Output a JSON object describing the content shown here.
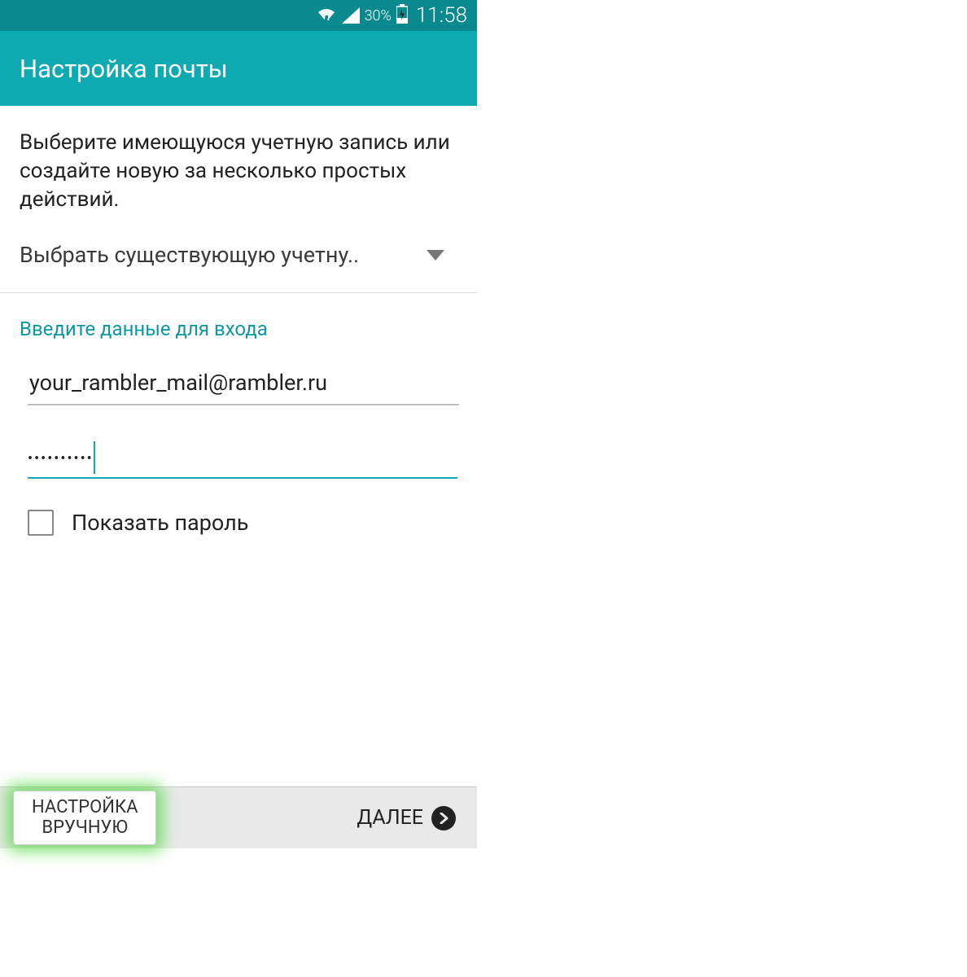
{
  "status_bar": {
    "battery_pct": "30%",
    "time": "11:58"
  },
  "app_bar": {
    "title": "Настройка почты"
  },
  "intro_text": "Выберите имеющуюся учетную запись или создайте новую за несколько простых действий.",
  "dropdown": {
    "selected": "Выбрать существующую учетну.."
  },
  "section_label": "Введите данные для входа",
  "email_field": {
    "value": "your_rambler_mail@rambler.ru"
  },
  "password_field": {
    "masked_value": "••••••••••"
  },
  "show_password": {
    "label": "Показать пароль",
    "checked": false
  },
  "buttons": {
    "manual_line1": "НАСТРОЙКА",
    "manual_line2": "ВРУЧНУЮ",
    "next": "ДАЛЕЕ"
  }
}
